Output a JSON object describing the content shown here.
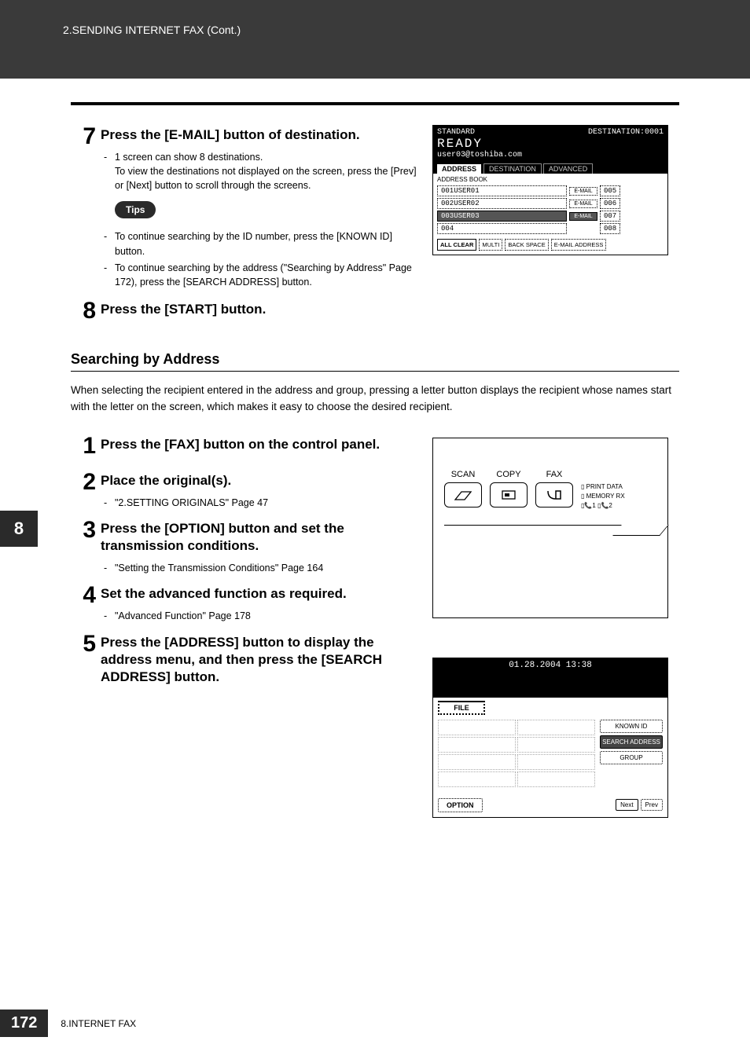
{
  "header": {
    "breadcrumb": "2.SENDING INTERNET FAX (Cont.)"
  },
  "sideTab": "8",
  "footer": {
    "page": "172",
    "chapter": "8.INTERNET FAX"
  },
  "step7": {
    "title": "Press the [E-MAIL] button of destination.",
    "bullets": [
      "1 screen can show 8 destinations.\nTo view the destinations not displayed on the screen, press the [Prev] or [Next] button to scroll through the screens."
    ],
    "tipsLabel": "Tips",
    "tips": [
      "To continue searching by the ID number, press the [KNOWN ID] button.",
      "To continue searching by the address (\"Searching by Address\"  Page 172), press the [SEARCH ADDRESS] button."
    ]
  },
  "step8": {
    "title": "Press the [START] button."
  },
  "section": {
    "heading": "Searching by Address",
    "para": "When selecting the recipient entered in the address and group, pressing a letter button displays the recipient whose names start with the letter on the screen, which makes it easy to choose the desired recipient."
  },
  "stepsB": {
    "s1": {
      "title": "Press the [FAX] button on the control panel."
    },
    "s2": {
      "title": "Place the original(s).",
      "ref": "\"2.SETTING ORIGINALS\"  Page 47"
    },
    "s3": {
      "title": "Press the [OPTION] button and set the transmission conditions.",
      "ref": "\"Setting the Transmission Conditions\"  Page 164"
    },
    "s4": {
      "title": "Set the advanced function as required.",
      "ref": "\"Advanced Function\"  Page 178"
    },
    "s5": {
      "title": "Press the [ADDRESS] button to display the address menu, and then press the [SEARCH ADDRESS] button."
    }
  },
  "lcd": {
    "mode": "STANDARD",
    "dest": "DESTINATION:0001",
    "ready": "READY",
    "email": "user03@toshiba.com",
    "tabs": {
      "address": "ADDRESS",
      "destination": "DESTINATION",
      "advanced": "ADVANCED"
    },
    "sub": "ADDRESS BOOK",
    "rows": [
      {
        "left": "001USER01",
        "tag": "E-MAIL",
        "right": "005"
      },
      {
        "left": "002USER02",
        "tag": "E-MAIL",
        "right": "006"
      },
      {
        "left": "003USER03",
        "tag": "E-MAIL",
        "right": "007",
        "sel": true
      },
      {
        "left": "004",
        "tag": "",
        "right": "008"
      }
    ],
    "btns": {
      "allclear": "ALL CLEAR",
      "multi": "MULTI",
      "back": "BACK SPACE",
      "emailaddr": "E-MAIL ADDRESS"
    }
  },
  "ctrl": {
    "scan": "SCAN",
    "copy": "COPY",
    "fax": "FAX",
    "ind": {
      "print": "PRINT DATA",
      "memory": "MEMORY RX",
      "l1": "1",
      "l2": "2"
    }
  },
  "ts": {
    "time": "01.28.2004 13:38",
    "file": "FILE",
    "knownid": "KNOWN ID",
    "search": "SEARCH ADDRESS",
    "group": "GROUP",
    "option": "OPTION",
    "next": "Next",
    "prev": "Prev"
  }
}
